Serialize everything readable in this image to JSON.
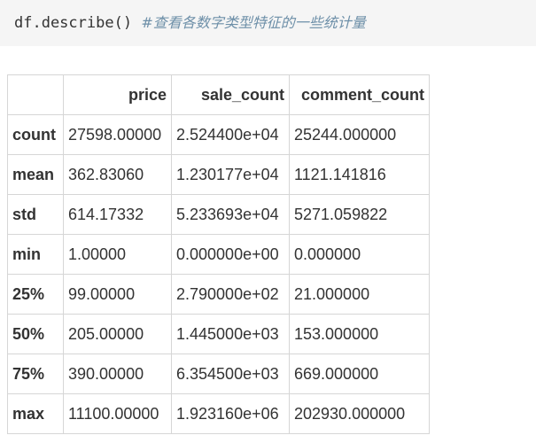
{
  "code": {
    "statement": "df.describe()",
    "comment": "#查看各数字类型特征的一些统计量"
  },
  "table": {
    "corner": "",
    "columns": [
      "price",
      "sale_count",
      "comment_count"
    ],
    "rows": [
      {
        "label": "count",
        "values": [
          "27598.00000",
          "2.524400e+04",
          "25244.000000"
        ]
      },
      {
        "label": "mean",
        "values": [
          "362.83060",
          "1.230177e+04",
          "1121.141816"
        ]
      },
      {
        "label": "std",
        "values": [
          "614.17332",
          "5.233693e+04",
          "5271.059822"
        ]
      },
      {
        "label": "min",
        "values": [
          "1.00000",
          "0.000000e+00",
          "0.000000"
        ]
      },
      {
        "label": "25%",
        "values": [
          "99.00000",
          "2.790000e+02",
          "21.000000"
        ]
      },
      {
        "label": "50%",
        "values": [
          "205.00000",
          "1.445000e+03",
          "153.000000"
        ]
      },
      {
        "label": "75%",
        "values": [
          "390.00000",
          "6.354500e+03",
          "669.000000"
        ]
      },
      {
        "label": "max",
        "values": [
          "11100.00000",
          "1.923160e+06",
          "202930.000000"
        ]
      }
    ]
  }
}
